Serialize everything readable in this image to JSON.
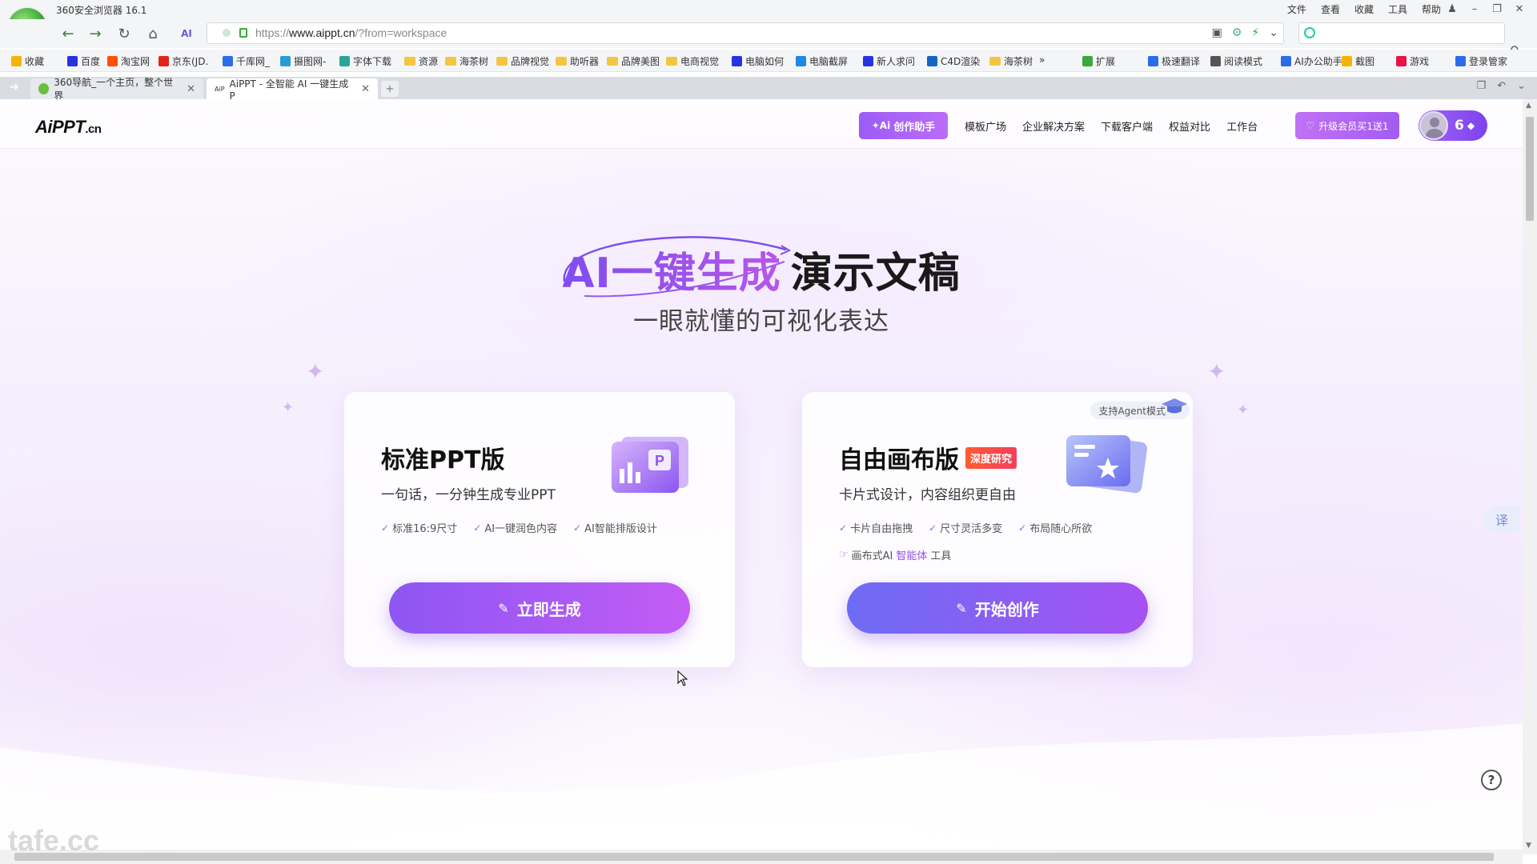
{
  "browser": {
    "app_title": "360安全浏览器 16.1",
    "menu": [
      "文件",
      "查看",
      "收藏",
      "工具",
      "帮助"
    ],
    "url_prefix": "https://",
    "url_host": "www.aippt.cn",
    "url_path": "/?from=workspace",
    "bookmarks": [
      {
        "label": "收藏",
        "icon": "star-icon",
        "color": "#f5b400"
      },
      {
        "label": "百度",
        "icon": "paw-icon",
        "color": "#2932e1"
      },
      {
        "label": "淘宝网",
        "icon": "taobao-icon",
        "color": "#ff5000"
      },
      {
        "label": "京东(JD.",
        "icon": "jd-icon",
        "color": "#e1251b"
      },
      {
        "label": "千库网_",
        "icon": "k-icon",
        "color": "#2b6de8"
      },
      {
        "label": "摄图网-",
        "icon": "globe-icon",
        "color": "#2b9bd8"
      },
      {
        "label": "字体下载",
        "icon": "map-pin-icon",
        "color": "#26a69a"
      },
      {
        "label": "资源",
        "icon": "folder-icon",
        "color": "#f5c542"
      },
      {
        "label": "海茶树",
        "icon": "folder-icon",
        "color": "#f5c542"
      },
      {
        "label": "品牌视觉",
        "icon": "folder-icon",
        "color": "#f5c542"
      },
      {
        "label": "助听器",
        "icon": "folder-icon",
        "color": "#f5c542"
      },
      {
        "label": "品牌美图",
        "icon": "folder-icon",
        "color": "#f5c542"
      },
      {
        "label": "电商视觉",
        "icon": "folder-icon",
        "color": "#f5c542"
      },
      {
        "label": "电脑如何",
        "icon": "paw-icon",
        "color": "#2932e1"
      },
      {
        "label": "电脑截屏",
        "icon": "edge-icon",
        "color": "#1e88e5"
      },
      {
        "label": "新人求问",
        "icon": "paw-icon",
        "color": "#2932e1"
      },
      {
        "label": "C4D渲染",
        "icon": "c4d-icon",
        "color": "#1565c0"
      },
      {
        "label": "海茶树",
        "icon": "folder-icon",
        "color": "#f5c542"
      }
    ],
    "bookmarks_more": "»",
    "right_tools": [
      "扩展",
      "极速翻译",
      "阅读模式",
      "AI办公助手",
      "截图",
      "游戏",
      "登录管家"
    ],
    "tabs": [
      {
        "label": "360导航_一个主页，整个世界",
        "active": false
      },
      {
        "label": "AiPPT - 全智能 AI 一键生成 P",
        "active": true
      }
    ]
  },
  "site": {
    "logo": "AiPPT",
    "logo_suffix": ".cn",
    "assistant_button": "创作助手",
    "nav": [
      "模板广场",
      "企业解决方案",
      "下载客户端",
      "权益对比",
      "工作台"
    ],
    "upgrade_button": "升级会员买1送1",
    "points": "6"
  },
  "hero": {
    "title_gradient": "AI一键生成",
    "title_dark": "演示文稿",
    "subtitle": "一眼就懂的可视化表达"
  },
  "cards": {
    "standard": {
      "title": "标准PPT版",
      "desc": "一句话，一分钟生成专业PPT",
      "features": [
        "标准16:9尺寸",
        "AI一键润色内容",
        "AI智能排版设计"
      ],
      "cta": "立即生成"
    },
    "canvas": {
      "title": "自由画布版",
      "badge": "深度研究",
      "agent_badge": "支持Agent模式",
      "desc": "卡片式设计，内容组织更自由",
      "features": [
        "卡片自由拖拽",
        "尺寸灵活多变",
        "布局随心所欲"
      ],
      "ai_tool_prefix": "画布式AI",
      "ai_tool_highlight": "智能体",
      "ai_tool_suffix": "工具",
      "cta": "开始创作"
    }
  },
  "floating": {
    "translate": "译",
    "help": "?"
  },
  "watermark": "tafe.cc",
  "colors": {
    "brand_purple": "#8d56f3",
    "brand_magenta": "#c35cf5",
    "badge_red": "#f43f5e"
  }
}
